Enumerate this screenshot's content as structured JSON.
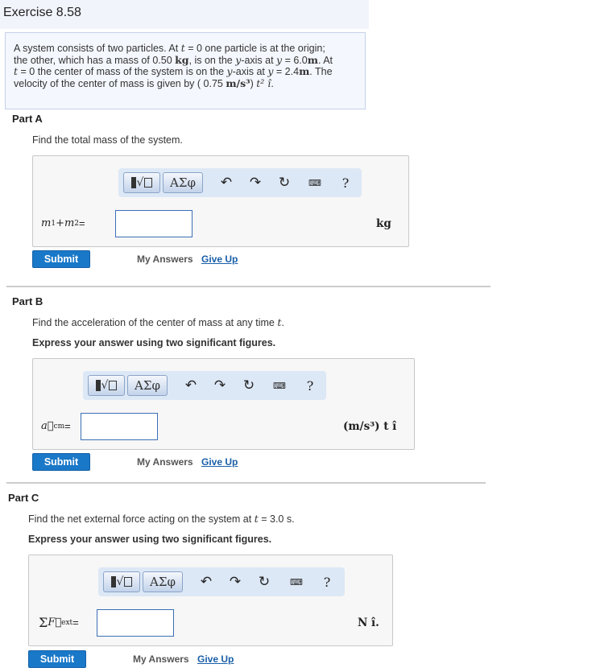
{
  "header": {
    "title": "Exercise 8.58"
  },
  "problem": {
    "s1": "A system consists of two particles. At ",
    "t": "t",
    "s2": " = 0 one particle is at the origin;",
    "s3": "the other, which has a mass of 0.50 ",
    "kg": "kg",
    "s4": ", is on the ",
    "y1": "y",
    "s5": "-axis at ",
    "y2": "y",
    "s6": " = 6.0",
    "m1": "m",
    "s7": ". At",
    "t2": "t",
    "s8": " = 0 the center of mass of the system is on the ",
    "y3": "y",
    "s9": "-axis at ",
    "y4": "y",
    "s10": " = 2.4",
    "m2": "m",
    "s11": ". The",
    "s12": "velocity of the center of mass is given by ( 0.75 ",
    "vunit": "m/s³",
    "s13": ") ",
    "t3": "t²",
    "ihat": " î",
    "s14": "."
  },
  "toolbar": {
    "greek_label": "ΑΣφ",
    "undo_icon": "↶",
    "redo_icon": "↷",
    "reset_icon": "↻",
    "keyboard_icon": "⌨",
    "help_label": "?"
  },
  "common": {
    "submit_label": "Submit",
    "my_answers_label": "My Answers",
    "give_up_label": "Give Up"
  },
  "parts": [
    {
      "label": "Part A",
      "prompt": "Find the total mass of the system.",
      "lhs_m1": "m",
      "lhs_sub1": "1",
      "lhs_plus": " + ",
      "lhs_m2": "m",
      "lhs_sub2": "2",
      "lhs_eq": " =",
      "answer_value": "",
      "unit": "kg"
    },
    {
      "label": "Part B",
      "prompt_a": "Find the acceleration of the center of mass at any time ",
      "prompt_var": "t",
      "prompt_b": ".",
      "instruction": "Express your answer using two significant figures.",
      "lhs_a": "a⃗",
      "lhs_sub": "cm",
      "lhs_eq": " =",
      "answer_value": "",
      "unit": "(m/s³) t î"
    },
    {
      "label": "Part C",
      "prompt_a": "Find the net external force acting on the system at ",
      "prompt_var": "t",
      "prompt_b": " = 3.0 s.",
      "instruction": "Express your answer using two significant figures.",
      "lhs_sum": "Σ",
      "lhs_f": "F⃗",
      "lhs_sub": "ext",
      "lhs_eq": " =",
      "answer_value": "",
      "unit": "N î."
    }
  ]
}
